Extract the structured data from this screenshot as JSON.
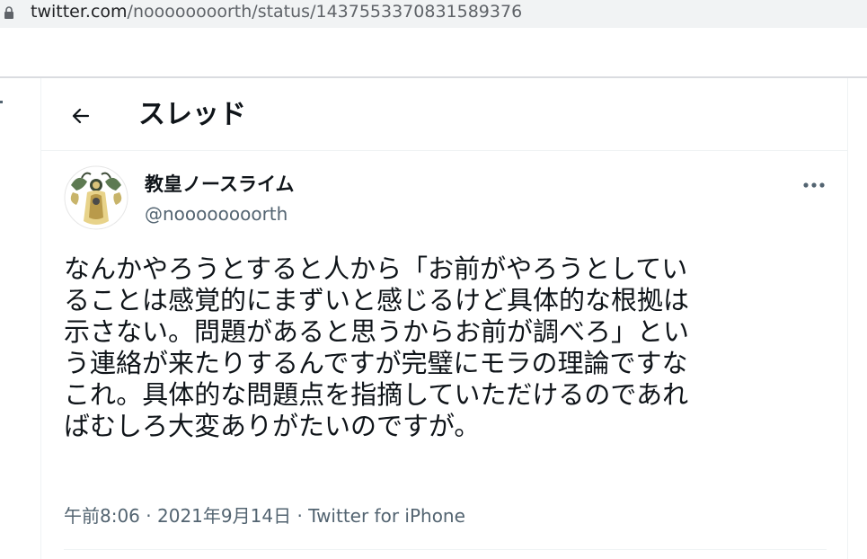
{
  "browser": {
    "url_host": "twitter.com",
    "url_path": "/noooooooorth/status/1437553370831589376"
  },
  "thread": {
    "title": "スレッド"
  },
  "tweet": {
    "author_name": "教皇ノースライム",
    "author_handle": "@noooooooorth",
    "text_lines": [
      "なんかやろうとすると人から「お前がやろうとしてい",
      "ることは感覚的にまずいと感じるけど具体的な根拠は",
      "示さない。問題があると思うからお前が調べろ」とい",
      "う連絡が来たりするんですが完璧にモラの理論ですな",
      "これ。具体的な問題点を指摘していただけるのであれ",
      "ばむしろ大変ありがたいのですが。"
    ],
    "time": "午前8:06",
    "separator": "·",
    "date": "2021年9月14日",
    "source": "Twitter for iPhone"
  },
  "icons": {
    "lock": "lock-icon",
    "back": "arrow-left-icon",
    "more": "more-horizontal-icon"
  },
  "colors": {
    "text_primary": "#0f1419",
    "text_secondary": "#536471",
    "divider": "#eff3f4",
    "url_bar": "#f1f3f4"
  }
}
